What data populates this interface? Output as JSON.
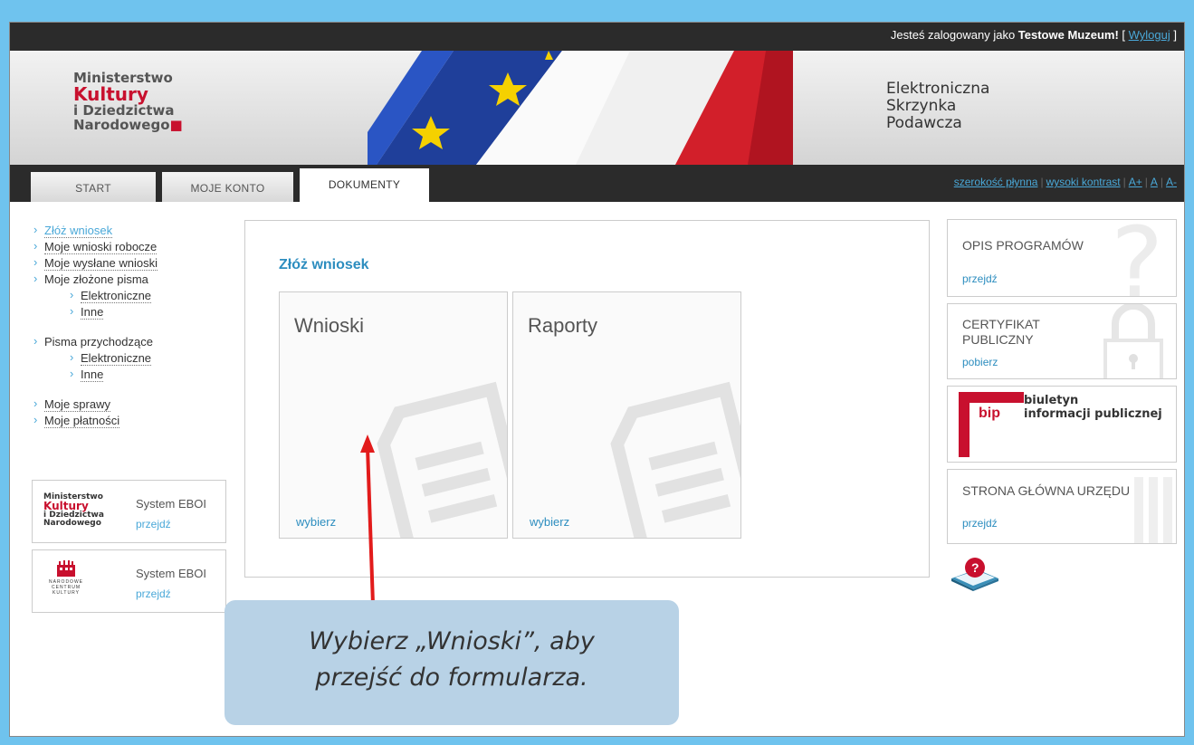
{
  "topbar": {
    "prefix": "Jesteś zalogowany jako ",
    "user": "Testowe Muzeum!",
    "open_bracket": " [ ",
    "logout_label": "Wyloguj",
    "close_bracket": " ]"
  },
  "banner": {
    "logo": {
      "line1": "Ministerstwo",
      "line2": "Kultury",
      "line3": "i Dziedzictwa",
      "line4": "Narodowego"
    },
    "title": {
      "line1": "Elektroniczna",
      "line2": "Skrzynka",
      "line3": "Podawcza"
    }
  },
  "tabs": [
    {
      "label": "START"
    },
    {
      "label": "MOJE KONTO"
    },
    {
      "label": "DOKUMENTY"
    }
  ],
  "accessibility": {
    "fluid_width": "szerokość płynna",
    "high_contrast": "wysoki kontrast",
    "font_plus": "A+",
    "font_normal": "A",
    "font_minus": "A-",
    "sep": "|"
  },
  "leftnav": {
    "submit": "Złóż wniosek",
    "drafts": "Moje wnioski robocze",
    "sent": "Moje wysłane wnioski",
    "filed": "Moje złożone pisma",
    "filed_electronic": "Elektroniczne",
    "filed_other": "Inne",
    "incoming": "Pisma przychodzące",
    "incoming_electronic": "Elektroniczne",
    "incoming_other": "Inne",
    "cases": "Moje sprawy",
    "payments": "Moje płatności"
  },
  "systems": [
    {
      "title": "System EBOI",
      "link": "przejdź",
      "logo": {
        "l1": "Ministerstwo",
        "l2": "Kultury",
        "l3": "i Dziedzictwa",
        "l4": "Narodowego"
      }
    },
    {
      "title": "System EBOI",
      "link": "przejdź",
      "logo": {
        "l1": "NARODOWE",
        "l2": "CENTRUM",
        "l3": "KULTURY"
      }
    }
  ],
  "main": {
    "title": "Złóż wniosek",
    "cards": [
      {
        "title": "Wnioski",
        "link": "wybierz"
      },
      {
        "title": "Raporty",
        "link": "wybierz"
      }
    ]
  },
  "right": {
    "programs": {
      "title": "OPIS PROGRAMÓW",
      "link": "przejdź"
    },
    "certificate": {
      "title_line1": "CERTYFIKAT",
      "title_line2": "PUBLICZNY",
      "link": "pobierz"
    },
    "bip": {
      "logo": "bip",
      "line1": "biuletyn",
      "line2": "informacji publicznej"
    },
    "office": {
      "title": "STRONA GŁÓWNA URZĘDU",
      "link": "przejdź"
    }
  },
  "callout": {
    "line1": "Wybierz „Wnioski”, aby",
    "line2": "przejść do formularza."
  },
  "colors": {
    "accent": "#2c8dbf",
    "brand_red": "#c8102e",
    "dark_bar": "#2b2b2b",
    "callout_bg": "#b8d2e6"
  }
}
